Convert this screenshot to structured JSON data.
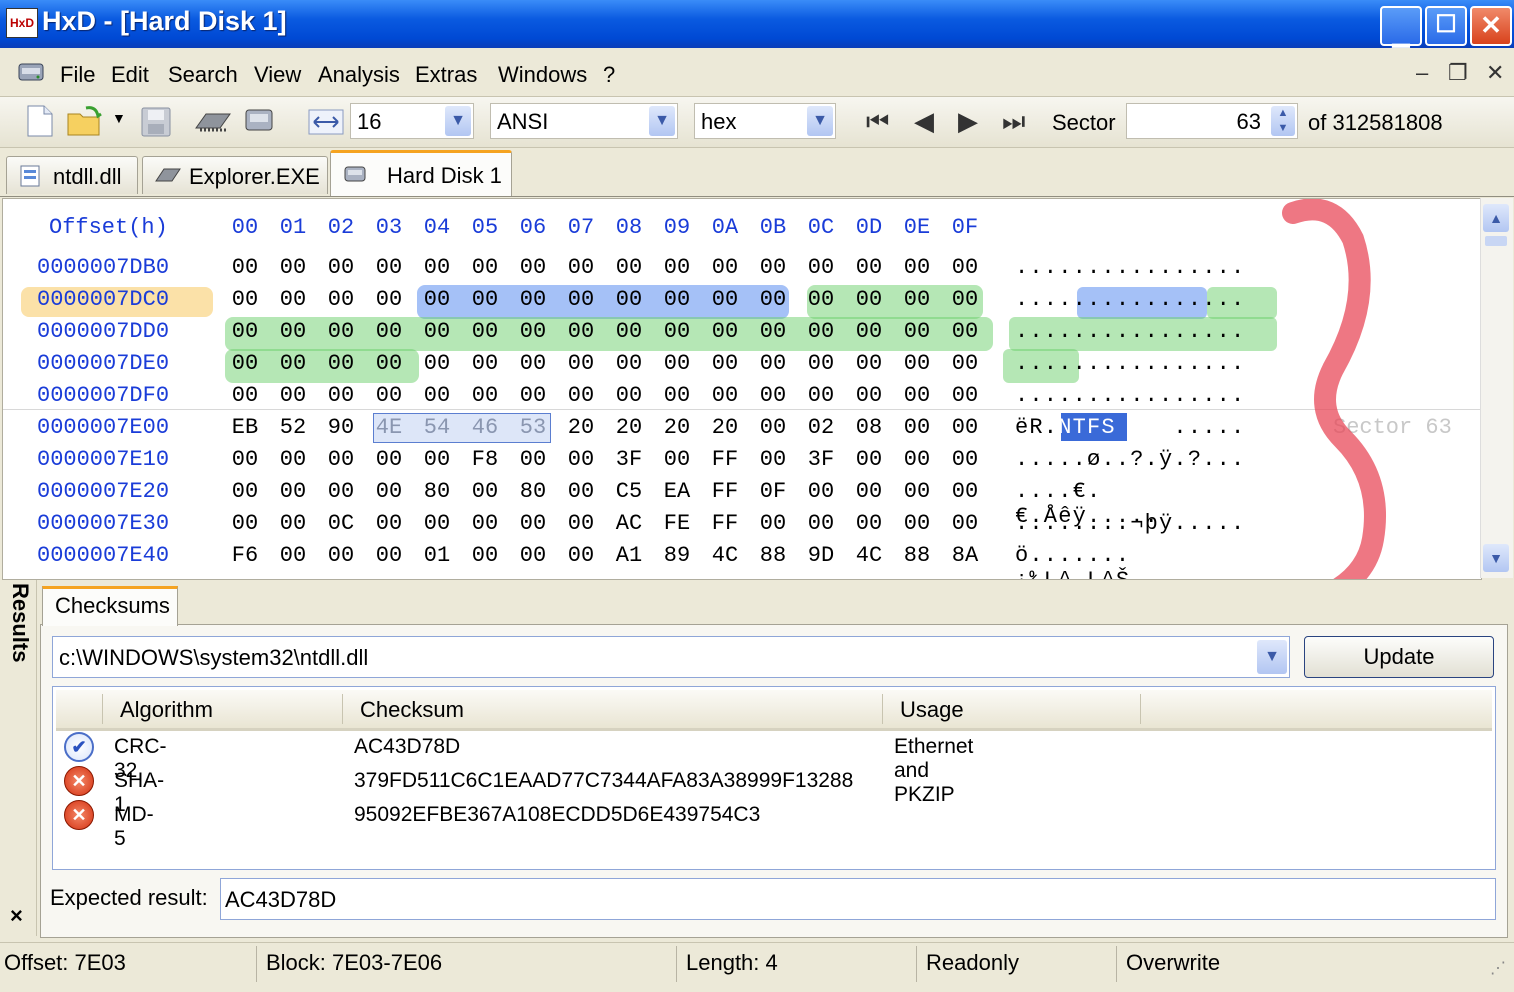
{
  "window": {
    "title": "HxD - [Hard Disk 1]",
    "app_icon_text": "HxD"
  },
  "menu": [
    "File",
    "Edit",
    "Search",
    "View",
    "Analysis",
    "Extras",
    "Windows",
    "?"
  ],
  "toolbar": {
    "bytes_per_row": "16",
    "charset": "ANSI",
    "offset_base": "hex",
    "sector_label": "Sector",
    "sector_value": "63",
    "sector_total": "of 312581808"
  },
  "tabs": [
    {
      "label": "ntdll.dll",
      "icon": "dll-file-icon",
      "active": false
    },
    {
      "label": "Explorer.EXE",
      "icon": "memory-chip-icon",
      "active": false
    },
    {
      "label": "Hard Disk 1",
      "icon": "hard-disk-icon",
      "active": true
    }
  ],
  "hex": {
    "header_offset": "Offset(h)",
    "columns": [
      "00",
      "01",
      "02",
      "03",
      "04",
      "05",
      "06",
      "07",
      "08",
      "09",
      "0A",
      "0B",
      "0C",
      "0D",
      "0E",
      "0F"
    ],
    "rows": [
      {
        "offset": "0000007DB0",
        "bytes": [
          "00",
          "00",
          "00",
          "00",
          "00",
          "00",
          "00",
          "00",
          "00",
          "00",
          "00",
          "00",
          "00",
          "00",
          "00",
          "00"
        ],
        "text": "................"
      },
      {
        "offset": "0000007DC0",
        "bytes": [
          "00",
          "00",
          "00",
          "00",
          "00",
          "00",
          "00",
          "00",
          "00",
          "00",
          "00",
          "00",
          "00",
          "00",
          "00",
          "00"
        ],
        "text": "................"
      },
      {
        "offset": "0000007DD0",
        "bytes": [
          "00",
          "00",
          "00",
          "00",
          "00",
          "00",
          "00",
          "00",
          "00",
          "00",
          "00",
          "00",
          "00",
          "00",
          "00",
          "00"
        ],
        "text": "................"
      },
      {
        "offset": "0000007DE0",
        "bytes": [
          "00",
          "00",
          "00",
          "00",
          "00",
          "00",
          "00",
          "00",
          "00",
          "00",
          "00",
          "00",
          "00",
          "00",
          "00",
          "00"
        ],
        "text": "................"
      },
      {
        "offset": "0000007DF0",
        "bytes": [
          "00",
          "00",
          "00",
          "00",
          "00",
          "00",
          "00",
          "00",
          "00",
          "00",
          "00",
          "00",
          "00",
          "00",
          "00",
          "00"
        ],
        "text": "................"
      },
      {
        "offset": "0000007E00",
        "bytes": [
          "EB",
          "52",
          "90",
          "4E",
          "54",
          "46",
          "53",
          "20",
          "20",
          "20",
          "20",
          "00",
          "02",
          "08",
          "00",
          "00"
        ],
        "text_pre": "ëR.",
        "text_sel": "NTFS",
        "text_post": "    ....."
      },
      {
        "offset": "0000007E10",
        "bytes": [
          "00",
          "00",
          "00",
          "00",
          "00",
          "F8",
          "00",
          "00",
          "3F",
          "00",
          "FF",
          "00",
          "3F",
          "00",
          "00",
          "00"
        ],
        "text": ".....ø..?.ÿ.?..."
      },
      {
        "offset": "0000007E20",
        "bytes": [
          "00",
          "00",
          "00",
          "00",
          "80",
          "00",
          "80",
          "00",
          "C5",
          "EA",
          "FF",
          "0F",
          "00",
          "00",
          "00",
          "00"
        ],
        "text": "....€.€.Åêÿ....."
      },
      {
        "offset": "0000007E30",
        "bytes": [
          "00",
          "00",
          "0C",
          "00",
          "00",
          "00",
          "00",
          "00",
          "AC",
          "FE",
          "FF",
          "00",
          "00",
          "00",
          "00",
          "00"
        ],
        "text": "........¬þÿ....."
      },
      {
        "offset": "0000007E40",
        "bytes": [
          "F6",
          "00",
          "00",
          "00",
          "01",
          "00",
          "00",
          "00",
          "A1",
          "89",
          "4C",
          "88",
          "9D",
          "4C",
          "88",
          "8A"
        ],
        "text": "ö.......¡‰L^.L^Š"
      }
    ],
    "sector_annotation": "Sector 63"
  },
  "results": {
    "side_label": "Results",
    "close_glyph": "×",
    "tab_label": "Checksums",
    "file_path": "c:\\WINDOWS\\system32\\ntdll.dll",
    "update_label": "Update",
    "columns": [
      "Algorithm",
      "Checksum",
      "Usage"
    ],
    "items": [
      {
        "status": "ok",
        "algorithm": "CRC-32",
        "checksum": "AC43D78D",
        "usage": "Ethernet and PKZIP"
      },
      {
        "status": "error",
        "algorithm": "SHA-1",
        "checksum": "379FD511C6C1EAAD77C7344AFA83A38999F13288",
        "usage": ""
      },
      {
        "status": "error",
        "algorithm": "MD-5",
        "checksum": "95092EFBE367A108ECDD5D6E439754C3",
        "usage": ""
      }
    ],
    "expected_label": "Expected result:",
    "expected_value": "AC43D78D"
  },
  "status": {
    "offset": "Offset: 7E03",
    "block": "Block: 7E03-7E06",
    "length": "Length: 4",
    "readonly": "Readonly",
    "mode": "Overwrite"
  },
  "colors": {
    "title_blue": "#0a5ae0",
    "offset_blue": "#1a3cd8",
    "highlight_blue": "#5b8ef0",
    "highlight_green": "#6cd06c",
    "highlight_orange": "#f7c860",
    "annotation_red": "#e84a5a"
  }
}
